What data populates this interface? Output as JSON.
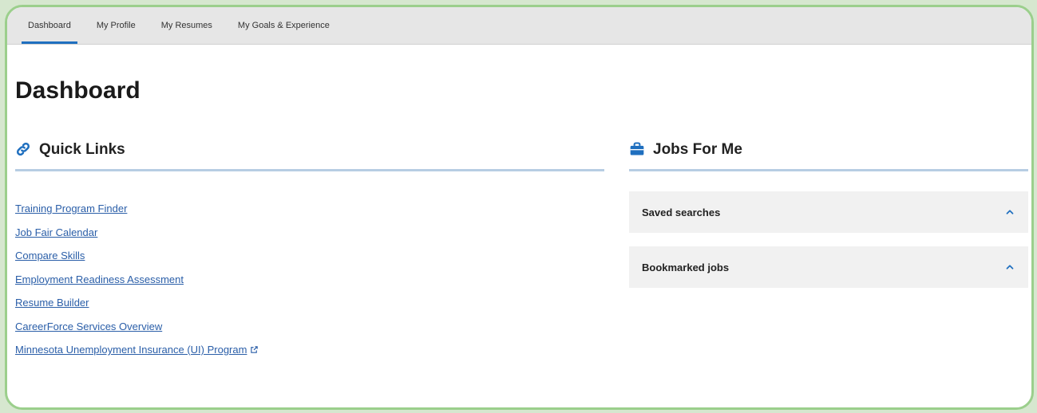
{
  "tabs": [
    {
      "label": "Dashboard",
      "active": true
    },
    {
      "label": "My Profile",
      "active": false
    },
    {
      "label": "My Resumes",
      "active": false
    },
    {
      "label": "My Goals & Experience",
      "active": false
    }
  ],
  "page_title": "Dashboard",
  "quick_links": {
    "title": "Quick Links",
    "icon": "link-icon",
    "items": [
      "Training Program Finder",
      "Job Fair Calendar",
      "Compare Skills",
      "Employment Readiness Assessment",
      "Resume Builder",
      "CareerForce Services Overview",
      "Minnesota Unemployment Insurance (UI) Program"
    ],
    "external_icon": "external-link-icon"
  },
  "jobs_for_me": {
    "title": "Jobs For Me",
    "icon": "briefcase-icon",
    "panels": [
      {
        "label": "Saved searches",
        "icon": "chevron-up-icon"
      },
      {
        "label": "Bookmarked jobs",
        "icon": "chevron-up-icon"
      }
    ]
  },
  "colors": {
    "link": "#2a5ea8",
    "accent": "#1f6fbf",
    "frame_border": "#9bcf8c",
    "section_rule": "#b7cde3"
  }
}
